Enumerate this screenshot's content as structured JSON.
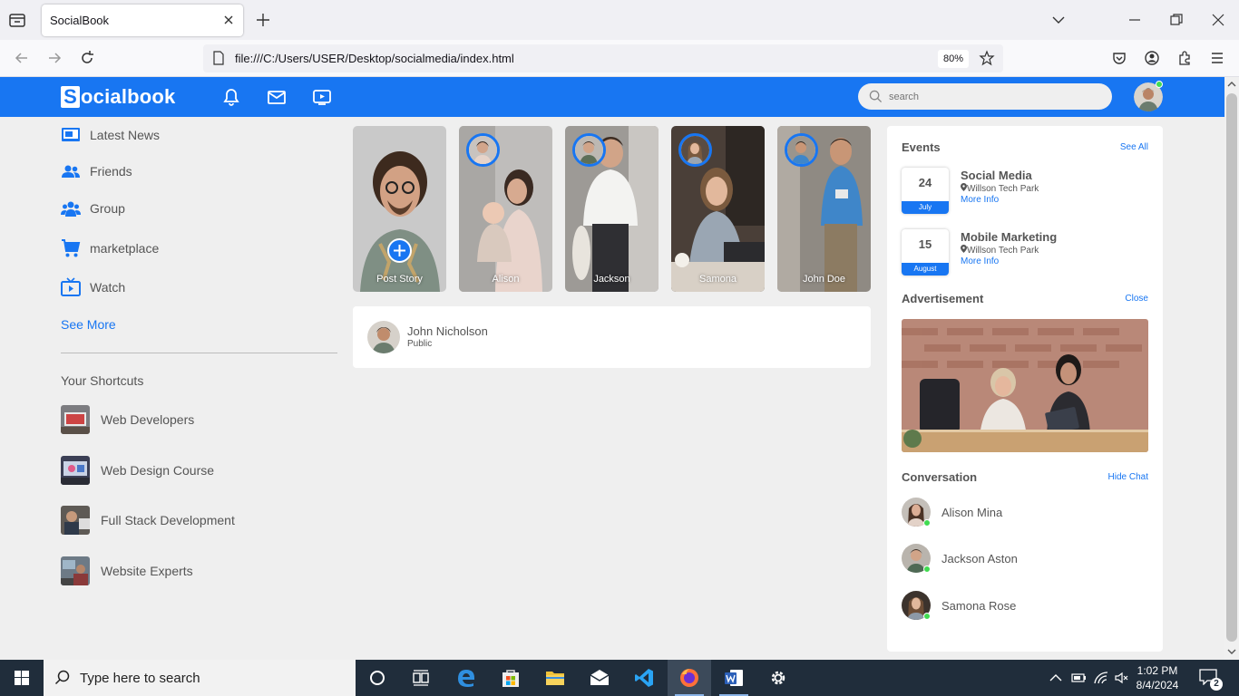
{
  "browser": {
    "tab_title": "SocialBook",
    "url": "file:///C:/Users/USER/Desktop/socialmedia/index.html",
    "zoom": "80%"
  },
  "site": {
    "logo_letter": "S",
    "logo_rest": "ocialbook",
    "search_placeholder": "search",
    "brand_color": "#1876f2"
  },
  "sidebar": {
    "items": [
      {
        "label": "Latest News",
        "icon": "news-icon"
      },
      {
        "label": "Friends",
        "icon": "friends-icon"
      },
      {
        "label": "Group",
        "icon": "group-icon"
      },
      {
        "label": "marketplace",
        "icon": "cart-icon"
      },
      {
        "label": "Watch",
        "icon": "tv-icon"
      }
    ],
    "see_more": "See More",
    "shortcuts_title": "Your Shortcuts",
    "shortcuts": [
      {
        "label": "Web Developers"
      },
      {
        "label": "Web Design Course"
      },
      {
        "label": "Full Stack Development"
      },
      {
        "label": "Website Experts"
      }
    ]
  },
  "stories": [
    {
      "name": "Post Story"
    },
    {
      "name": "Alison"
    },
    {
      "name": "Jackson"
    },
    {
      "name": "Samona"
    },
    {
      "name": "John Doe"
    }
  ],
  "post_box": {
    "name": "John Nicholson",
    "visibility": "Public"
  },
  "events": {
    "title": "Events",
    "see_all": "See All",
    "items": [
      {
        "day": "24",
        "month": "July",
        "title": "Social Media",
        "location": "Willson Tech Park",
        "more": "More Info"
      },
      {
        "day": "15",
        "month": "August",
        "title": "Mobile Marketing",
        "location": "Willson Tech Park",
        "more": "More Info"
      }
    ]
  },
  "advertisement": {
    "title": "Advertisement",
    "close": "Close"
  },
  "conversation": {
    "title": "Conversation",
    "hide": "Hide Chat",
    "contacts": [
      {
        "name": "Alison Mina"
      },
      {
        "name": "Jackson Aston"
      },
      {
        "name": "Samona Rose"
      }
    ]
  },
  "taskbar": {
    "search_text": "Type here to search",
    "time": "1:02 PM",
    "date": "8/4/2024",
    "notification_count": "2"
  }
}
